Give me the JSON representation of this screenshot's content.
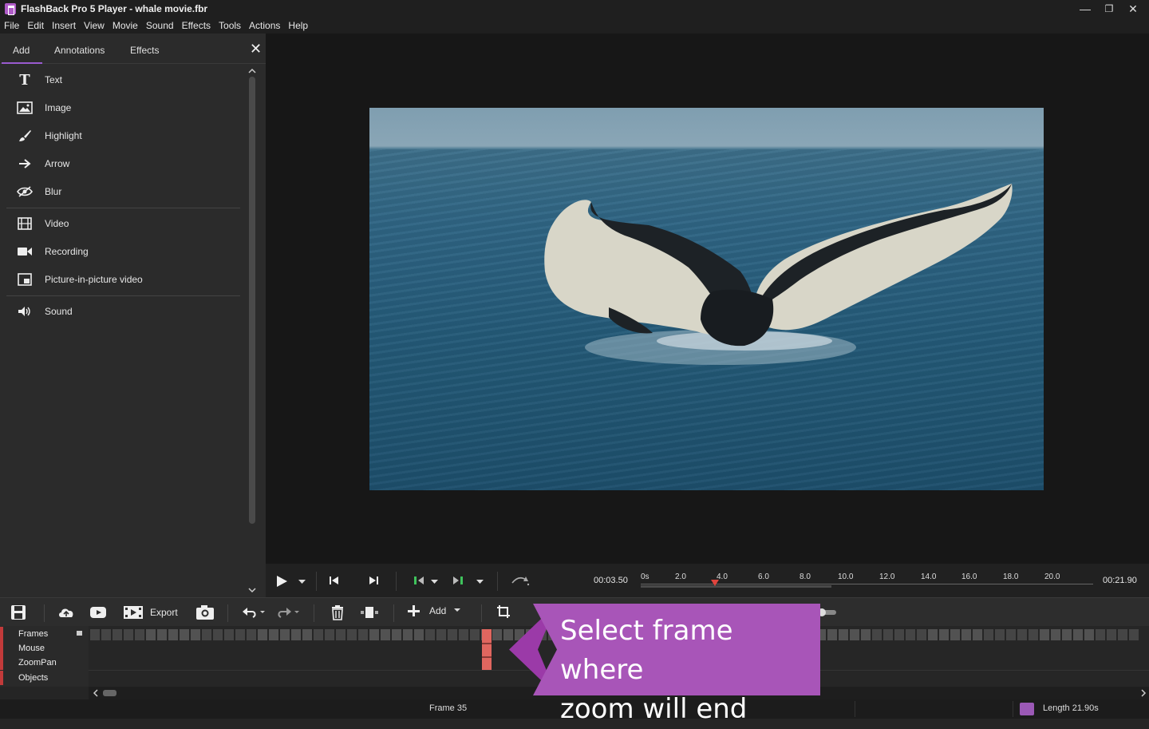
{
  "window": {
    "title": "FlashBack Pro 5 Player - whale movie.fbr",
    "controls": {
      "minimize": "—",
      "restore": "❐",
      "close": "✕"
    }
  },
  "menubar": {
    "items": [
      "File",
      "Edit",
      "Insert",
      "View",
      "Movie",
      "Sound",
      "Effects",
      "Tools",
      "Actions",
      "Help"
    ]
  },
  "left_panel": {
    "tabs": [
      "Add",
      "Annotations",
      "Effects"
    ],
    "active_tab": "Add",
    "close_glyph": "✕",
    "groups": [
      {
        "items": [
          {
            "label": "Text",
            "icon": "text-icon"
          },
          {
            "label": "Image",
            "icon": "image-icon"
          },
          {
            "label": "Highlight",
            "icon": "brush-icon"
          },
          {
            "label": "Arrow",
            "icon": "arrow-icon"
          },
          {
            "label": "Blur",
            "icon": "blur-icon"
          }
        ]
      },
      {
        "items": [
          {
            "label": "Video",
            "icon": "film-icon"
          },
          {
            "label": "Recording",
            "icon": "camera-icon"
          },
          {
            "label": "Picture-in-picture video",
            "icon": "pip-icon"
          }
        ]
      },
      {
        "items": [
          {
            "label": "Sound",
            "icon": "speaker-icon"
          }
        ]
      }
    ]
  },
  "transport": {
    "current_time": "00:03.50",
    "total_time": "00:21.90",
    "ruler_ticks": [
      "0s",
      "2.0",
      "4.0",
      "6.0",
      "8.0",
      "10.0",
      "12.0",
      "14.0",
      "16.0",
      "18.0",
      "20.0"
    ]
  },
  "toolbar": {
    "export_label": "Export",
    "add_label": "Add"
  },
  "timeline": {
    "tracks": [
      "Frames",
      "Mouse",
      "ZoomPan",
      "Objects"
    ],
    "selected_frame_color": "#e0665f"
  },
  "status": {
    "frame": "Frame 35",
    "length": "Length 21.90s"
  },
  "callout": {
    "line1": "Select frame where",
    "line2": "zoom will end",
    "color": "#a855b8"
  },
  "colors": {
    "accent": "#9a5bd0",
    "playhead": "#e0443d"
  }
}
